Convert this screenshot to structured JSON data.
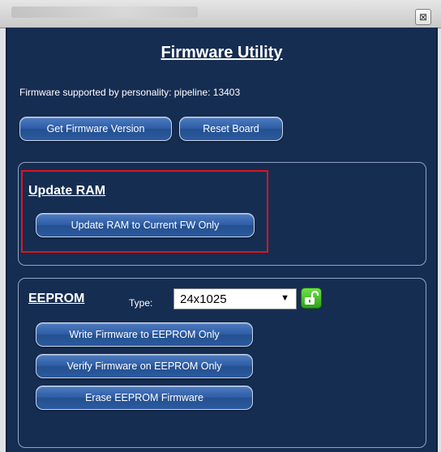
{
  "window": {
    "title": "Firmware Utility",
    "close_glyph": "⊠",
    "support_text": "Firmware supported by personality: pipeline: 13403"
  },
  "toolbar": {
    "get_version_label": "Get Firmware Version",
    "reset_label": "Reset Board"
  },
  "update_ram": {
    "title": "Update RAM",
    "button_label": "Update RAM to Current FW Only"
  },
  "eeprom": {
    "title": "EEPROM",
    "type_label": "Type:",
    "type_value": "24x1025",
    "lock_icon": "unlocked-padlock-icon",
    "write_label": "Write Firmware to EEPROM Only",
    "verify_label": "Verify Firmware on EEPROM Only",
    "erase_label": "Erase EEPROM Firmware"
  },
  "colors": {
    "window_bg": "#162d52",
    "button_blue": "#2e5da6",
    "highlight_red": "#e0141c",
    "lock_green": "#3cbf1f"
  }
}
